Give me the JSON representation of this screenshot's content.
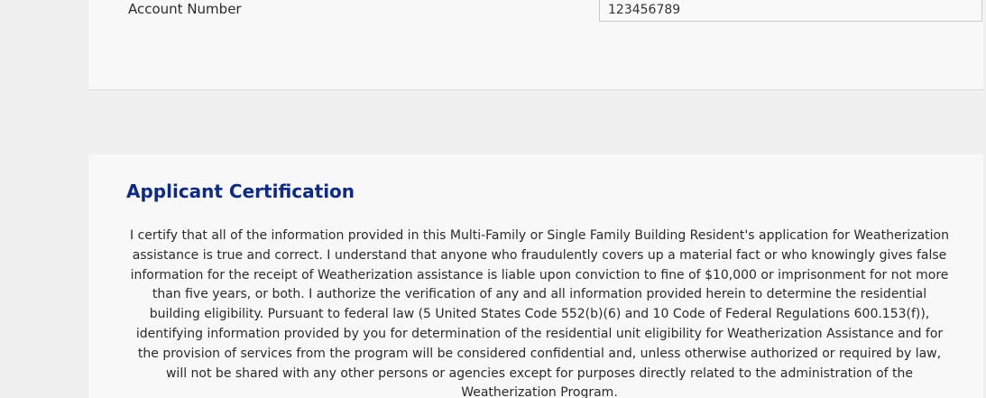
{
  "account": {
    "label": "Account Number",
    "value": "123456789"
  },
  "certification": {
    "title": "Applicant Certification",
    "text": "I certify that all of the information provided in this Multi-Family or Single Family Building Resident's application for Weatherization assistance is true and correct. I understand that anyone who fraudulently covers up a material fact or who knowingly gives false information for the receipt of Weatherization assistance is liable upon conviction to fine of $10,000 or imprisonment for not more than five years, or both. I authorize the verification of any and all information provided herein to determine the residential building eligibility. Pursuant to federal law (5 United States Code 552(b)(6) and 10 Code of Federal Regulations 600.153(f)), identifying information provided by you for determination of the residential unit eligibility for Weatherization Assistance and for the provision of services from the program will be considered confidential and, unless otherwise authorized or required by law, will not be shared with any other persons or agencies except for purposes directly related to the administration of the Weatherization Program."
  },
  "colors": {
    "title": "#0d2a8a",
    "background": "#f0f0f0",
    "card": "#f8f8f8"
  }
}
